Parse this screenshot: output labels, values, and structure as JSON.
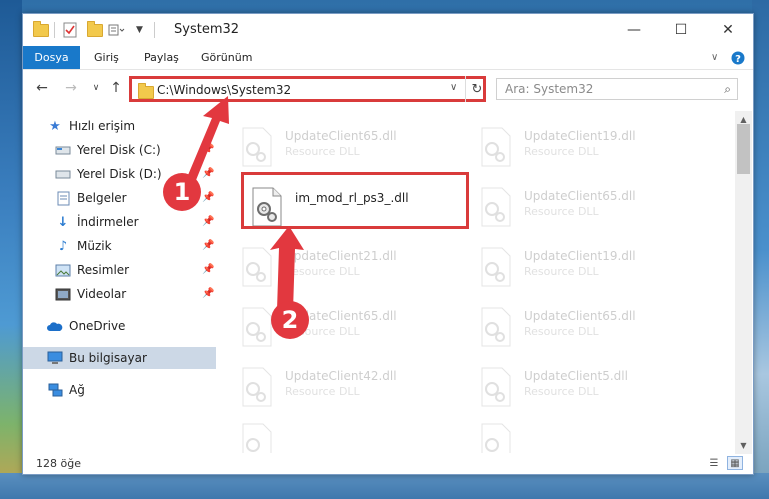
{
  "window": {
    "title": "System32",
    "controls": {
      "minimize": "—",
      "maximize": "☐",
      "close": "✕"
    }
  },
  "menu": {
    "file": "Dosya",
    "items": [
      "Giriş",
      "Paylaş",
      "Görünüm"
    ]
  },
  "address": {
    "path": "C:\\Windows\\System32",
    "search_placeholder": "Ara: System32"
  },
  "sidebar": {
    "quick_access": "Hızlı erişim",
    "items": [
      {
        "label": "Yerel Disk (C:)",
        "icon": "drive-icon",
        "pinned": true
      },
      {
        "label": "Yerel Disk (D:)",
        "icon": "drive-icon",
        "pinned": true
      },
      {
        "label": "Belgeler",
        "icon": "documents-icon",
        "pinned": true
      },
      {
        "label": "İndirmeler",
        "icon": "downloads-icon",
        "pinned": true
      },
      {
        "label": "Müzik",
        "icon": "music-icon",
        "pinned": true
      },
      {
        "label": "Resimler",
        "icon": "pictures-icon",
        "pinned": true
      },
      {
        "label": "Videolar",
        "icon": "videos-icon",
        "pinned": true
      }
    ],
    "onedrive": "OneDrive",
    "this_pc": "Bu bilgisayar",
    "network": "Ağ"
  },
  "files": {
    "highlighted": {
      "name": "im_mod_rl_ps3_.dll"
    },
    "col1": [
      {
        "name": "UpdateClient65.dll",
        "type": "Resource DLL"
      },
      {
        "name": "UpdateClient21.dll",
        "type": "Resource DLL"
      },
      {
        "name": "UpdateClient65.dll",
        "type": "Resource DLL"
      },
      {
        "name": "UpdateClient42.dll",
        "type": "Resource DLL"
      }
    ],
    "col2": [
      {
        "name": "UpdateClient19.dll",
        "type": "Resource DLL"
      },
      {
        "name": "UpdateClient65.dll",
        "type": "Resource DLL"
      },
      {
        "name": "UpdateClient19.dll",
        "type": "Resource DLL"
      },
      {
        "name": "UpdateClient65.dll",
        "type": "Resource DLL"
      },
      {
        "name": "UpdateClient5.dll",
        "type": "Resource DLL"
      }
    ]
  },
  "status": {
    "count": "128 öğe"
  },
  "annotations": {
    "step1": "1",
    "step2": "2",
    "color": "#e2383f"
  }
}
